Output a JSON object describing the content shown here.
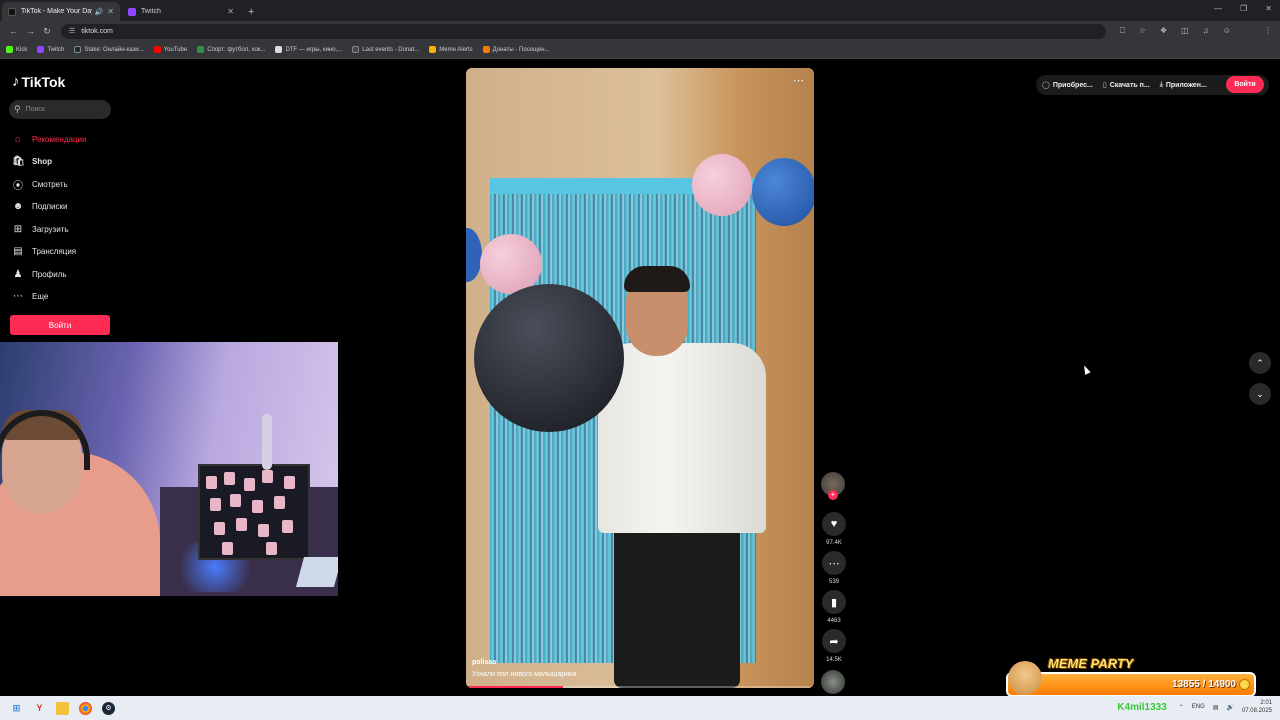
{
  "browser": {
    "tabs": [
      {
        "label": "TikTok - Make Your Day",
        "active": true,
        "color": "#111111"
      },
      {
        "label": "Twitch",
        "active": false,
        "color": "#9146ff"
      }
    ],
    "url": "tiktok.com",
    "bookmarks": [
      {
        "label": "Kick",
        "color": "#53fc18"
      },
      {
        "label": "Twitch",
        "color": "#9146ff"
      },
      {
        "label": "Stake: Онлайн-кази...",
        "color": "#1a2c38"
      },
      {
        "label": "YouTube",
        "color": "#ff0000"
      },
      {
        "label": "Спорт: футбол, хок...",
        "color": "#2f8f46"
      },
      {
        "label": "DTF — игры, кино,...",
        "color": "#dddddd"
      },
      {
        "label": "Last events - Donat...",
        "color": "#444444"
      },
      {
        "label": "Meme Alerts",
        "color": "#f5b400"
      },
      {
        "label": "Донаты - Посещен...",
        "color": "#f57c00"
      }
    ]
  },
  "sidebar": {
    "brand": "TikTok",
    "search_placeholder": "Поиск",
    "items": [
      {
        "label": "Рекомендации",
        "icon": "home-icon",
        "active": true
      },
      {
        "label": "Shop",
        "icon": "shop-icon",
        "active": false
      },
      {
        "label": "Смотреть",
        "icon": "compass-icon",
        "active": false
      },
      {
        "label": "Подписки",
        "icon": "following-icon",
        "active": false
      },
      {
        "label": "Загрузить",
        "icon": "upload-icon",
        "active": false
      },
      {
        "label": "Трансляция",
        "icon": "live-icon",
        "active": false
      },
      {
        "label": "Профиль",
        "icon": "profile-icon",
        "active": false
      },
      {
        "label": "Еще",
        "icon": "more-icon",
        "active": false
      }
    ],
    "login_label": "Войти"
  },
  "video": {
    "author": "polisaa",
    "description": "Узнали пол нового малышарика",
    "progress": 0.28
  },
  "actions": {
    "likes": "97.4K",
    "comments": "539",
    "saves": "4463",
    "shares": "14.5K"
  },
  "topbar": {
    "buy_label": "Приобрес...",
    "download_label": "Скачать п...",
    "app_label": "Приложен...",
    "login_label": "Войти"
  },
  "meme_party": {
    "title": "MEME PARTY",
    "score": "13855 / 14900"
  },
  "taskbar": {
    "nick": "K4mil1333",
    "lang": "ENG",
    "time": "2:01",
    "date": "07.08.2025"
  },
  "colors": {
    "accent": "#fe2c55"
  }
}
